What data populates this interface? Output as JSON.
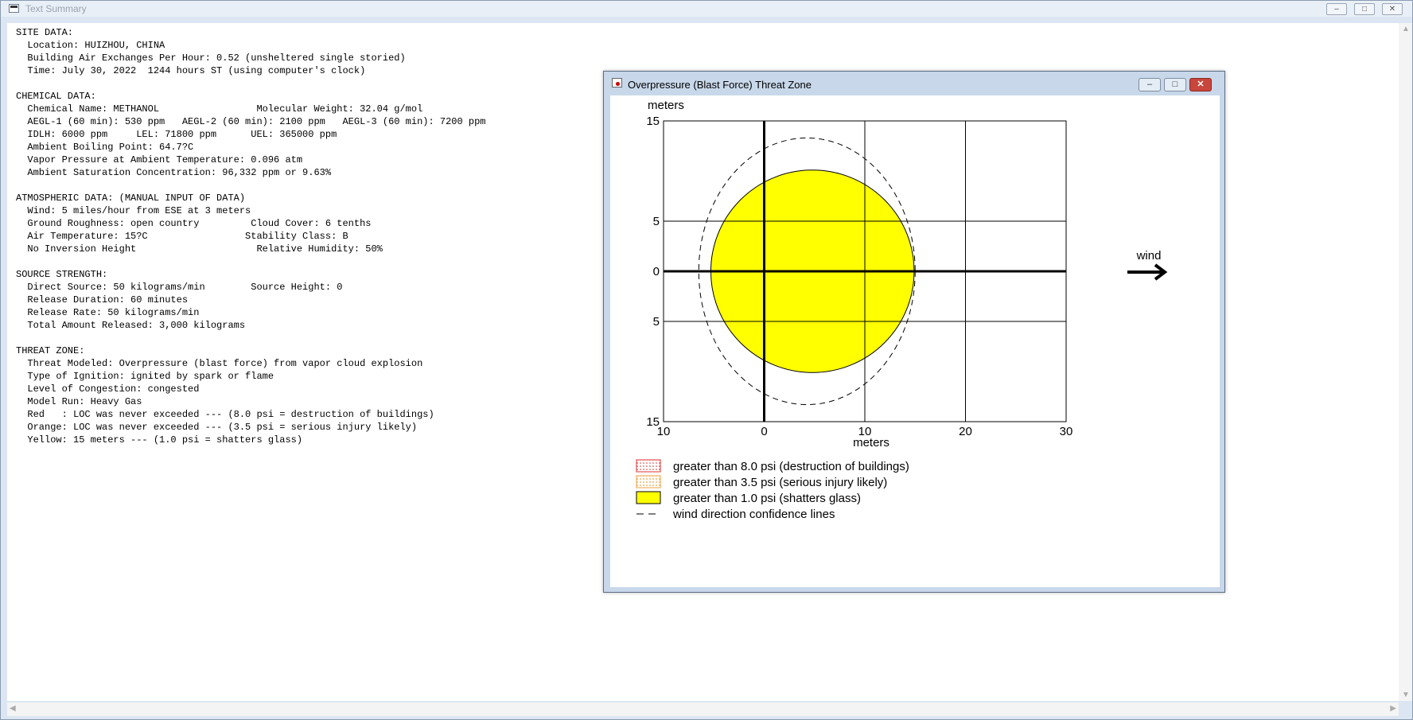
{
  "main_window": {
    "title": "Text Summary",
    "controls": {
      "minimize": "–",
      "maximize": "□",
      "close": "✕"
    }
  },
  "summary_text": "SITE DATA:\n  Location: HUIZHOU, CHINA\n  Building Air Exchanges Per Hour: 0.52 (unsheltered single storied)\n  Time: July 30, 2022  1244 hours ST (using computer's clock)\n\nCHEMICAL DATA:\n  Chemical Name: METHANOL                 Molecular Weight: 32.04 g/mol\n  AEGL-1 (60 min): 530 ppm   AEGL-2 (60 min): 2100 ppm   AEGL-3 (60 min): 7200 ppm\n  IDLH: 6000 ppm     LEL: 71800 ppm      UEL: 365000 ppm\n  Ambient Boiling Point: 64.7?C\n  Vapor Pressure at Ambient Temperature: 0.096 atm\n  Ambient Saturation Concentration: 96,332 ppm or 9.63%\n\nATMOSPHERIC DATA: (MANUAL INPUT OF DATA)\n  Wind: 5 miles/hour from ESE at 3 meters\n  Ground Roughness: open country         Cloud Cover: 6 tenths\n  Air Temperature: 15?C                 Stability Class: B\n  No Inversion Height                     Relative Humidity: 50%\n\nSOURCE STRENGTH:\n  Direct Source: 50 kilograms/min        Source Height: 0\n  Release Duration: 60 minutes\n  Release Rate: 50 kilograms/min\n  Total Amount Released: 3,000 kilograms\n\nTHREAT ZONE:\n  Threat Modeled: Overpressure (blast force) from vapor cloud explosion\n  Type of Ignition: ignited by spark or flame\n  Level of Congestion: congested\n  Model Run: Heavy Gas\n  Red   : LOC was never exceeded --- (8.0 psi = destruction of buildings)\n  Orange: LOC was never exceeded --- (3.5 psi = serious injury likely)\n  Yellow: 15 meters --- (1.0 psi = shatters glass)",
  "threat_window": {
    "title": "Overpressure (Blast Force) Threat Zone",
    "controls": {
      "minimize": "–",
      "maximize": "□",
      "close": "✕"
    }
  },
  "chart_data": {
    "type": "area",
    "ylabel": "meters",
    "xlabel": "meters",
    "x_ticks": [
      "10",
      "0",
      "10",
      "20",
      "30"
    ],
    "y_ticks": [
      "15",
      "5",
      "0",
      "5",
      "15"
    ],
    "xlim": [
      -10,
      30
    ],
    "ylim": [
      -15,
      15
    ],
    "grid": true,
    "wind_label": "wind",
    "threat_zone_yellow": {
      "shape": "circle",
      "center_x": 4.8,
      "center_y": 0,
      "radius": 10.1,
      "color": "#ffff00"
    },
    "confidence_lines": {
      "style": "dashed",
      "upwind_x": -6.5,
      "downwind_x": 15,
      "half_width_max": 13.3
    },
    "legend": [
      {
        "label": "greater than 8.0 psi (destruction of buildings)",
        "swatch": "red-dotted",
        "color": "#e03030"
      },
      {
        "label": "greater than 3.5 psi (serious injury likely)",
        "swatch": "orange-dotted",
        "color": "#f0a040"
      },
      {
        "label": "greater than 1.0 psi (shatters glass)",
        "swatch": "yellow-solid",
        "color": "#ffff00"
      },
      {
        "label": "wind direction confidence lines",
        "swatch": "dashed-line",
        "color": "#000000"
      }
    ]
  }
}
